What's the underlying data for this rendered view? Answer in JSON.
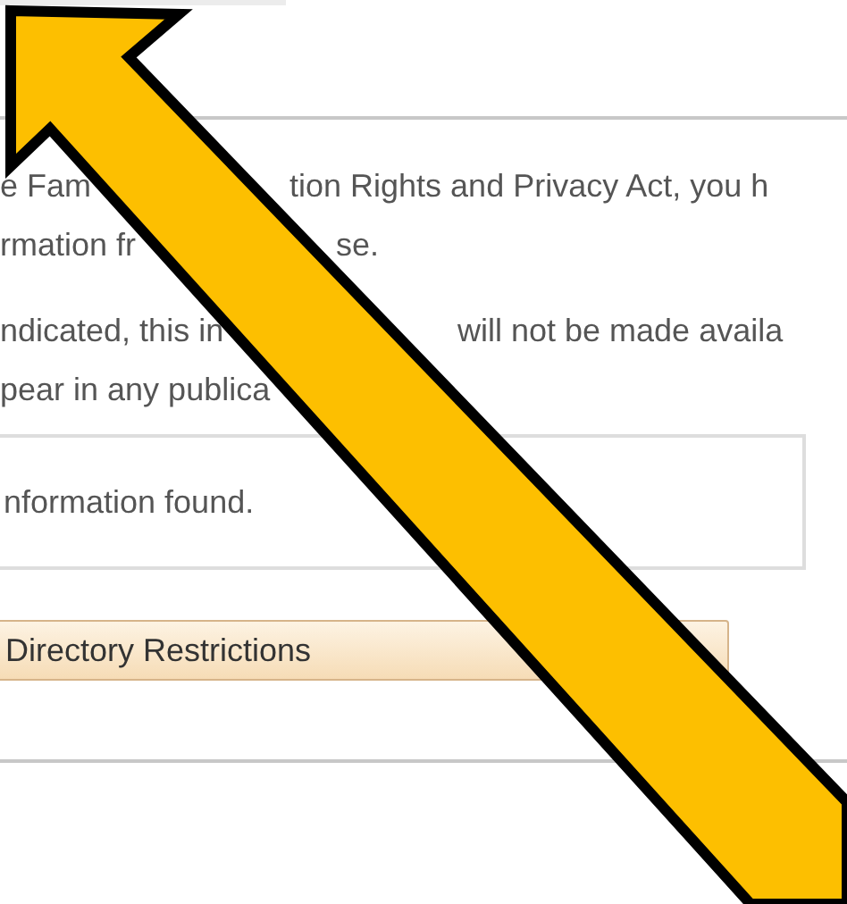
{
  "paragraphs": [
    {
      "lines": [
        [
          "e Fam",
          "tion Rights and Privacy Act, you h"
        ],
        [
          "rmation fr",
          "se."
        ]
      ]
    },
    {
      "lines": [
        [
          "ndicated, this in",
          "will not be made availa"
        ],
        [
          "pear in any publica"
        ]
      ]
    }
  ],
  "result_box": {
    "message": "nformation found."
  },
  "button": {
    "label": "Directory Restrictions"
  },
  "annotation": {
    "kind": "arrow"
  }
}
